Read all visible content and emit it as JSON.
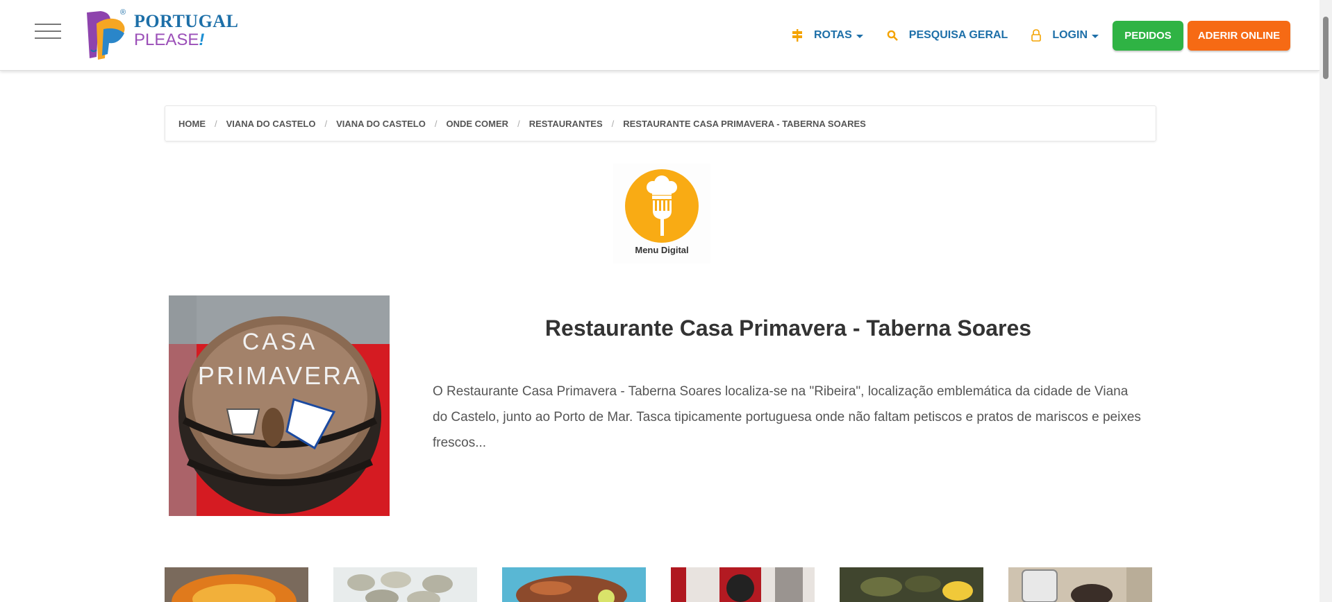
{
  "header": {
    "logo_line1": "PORTUGAL",
    "logo_line2": "PLEASE",
    "logo_exclaim": "!",
    "registered": "®",
    "nav": {
      "rotas": "ROTAS",
      "pesquisa": "PESQUISA GERAL",
      "login": "LOGIN"
    },
    "pedidos": "PEDIDOS",
    "aderir": "ADERIR ONLINE"
  },
  "breadcrumb": {
    "items": [
      "HOME",
      "VIANA DO CASTELO",
      "VIANA DO CASTELO",
      "ONDE COMER",
      "RESTAURANTES",
      "RESTAURANTE CASA PRIMAVERA - TABERNA SOARES"
    ],
    "separator": "/"
  },
  "menu_digital": {
    "label": "Menu Digital"
  },
  "main": {
    "title": "Restaurante Casa Primavera - Taberna Soares",
    "description": "O Restaurante Casa Primavera - Taberna Soares localiza-se na \"Ribeira\", localização emblemática da cidade de Viana do Castelo, junto ao Porto de Mar. Tasca tipicamente portuguesa onde não faltam petiscos e pratos de mariscos e peixes frescos...",
    "image_text_line1": "CASA",
    "image_text_line2": "PRIMAVERA"
  },
  "colors": {
    "brand_blue": "#1d6fa8",
    "accent_orange": "#f4a300",
    "green": "#2fb344",
    "orange": "#f66a14"
  }
}
